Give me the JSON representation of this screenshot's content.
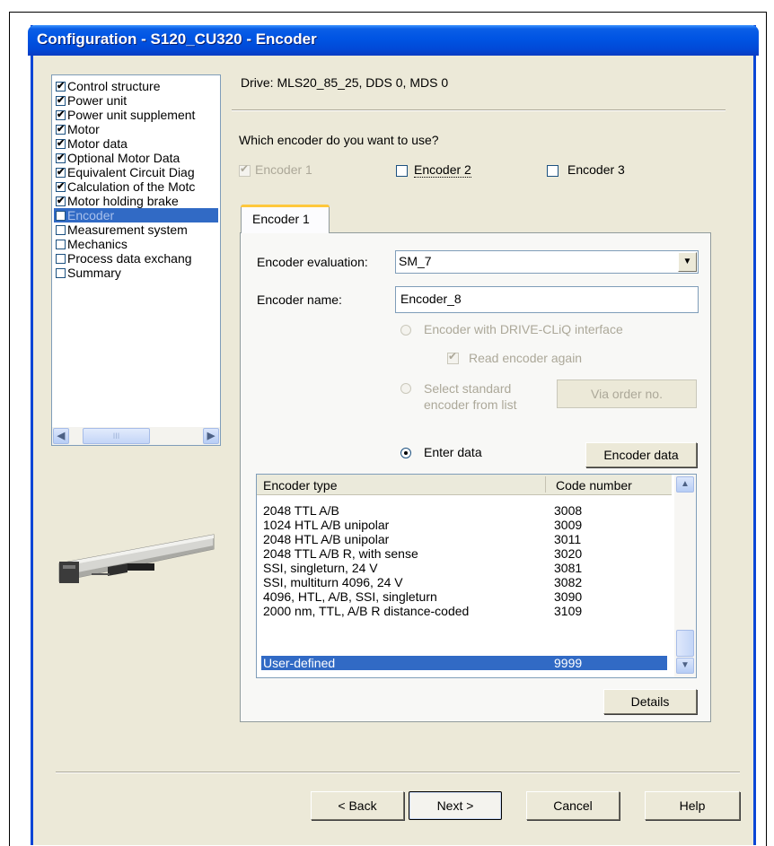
{
  "window": {
    "title": "Configuration - S120_CU320 - Encoder"
  },
  "sidebar": {
    "items": [
      {
        "label": "Control structure",
        "checked": true
      },
      {
        "label": "Power unit",
        "checked": true
      },
      {
        "label": "Power unit supplement",
        "checked": true
      },
      {
        "label": "Motor",
        "checked": true
      },
      {
        "label": "Motor data",
        "checked": true
      },
      {
        "label": "Optional Motor Data",
        "checked": true
      },
      {
        "label": "Equivalent Circuit Diag",
        "checked": true
      },
      {
        "label": "Calculation of the Motc",
        "checked": true
      },
      {
        "label": "Motor holding brake",
        "checked": true
      },
      {
        "label": "Encoder",
        "checked": false,
        "selected": true
      },
      {
        "label": "Measurement system",
        "checked": false
      },
      {
        "label": "Mechanics",
        "checked": false
      },
      {
        "label": "Process data exchang",
        "checked": false
      },
      {
        "label": "Summary",
        "checked": false
      }
    ],
    "scroll_thumb": "III"
  },
  "drive_info": "Drive: MLS20_85_25, DDS 0, MDS 0",
  "question": "Which encoder do you want to use?",
  "encoder_choices": [
    {
      "label": "Encoder 1",
      "checked": true,
      "enabled": false
    },
    {
      "label": "Encoder 2",
      "checked": false,
      "enabled": true
    },
    {
      "label": "Encoder 3",
      "checked": false,
      "enabled": true
    }
  ],
  "tab": {
    "label": "Encoder 1"
  },
  "form": {
    "evaluation_label": "Encoder evaluation:",
    "evaluation_value": "SM_7",
    "name_label": "Encoder name:",
    "name_value": "Encoder_8",
    "radio_driveclq": "Encoder with DRIVE-CLiQ interface",
    "read_again": "Read encoder again",
    "radio_standard_line1": "Select standard",
    "radio_standard_line2": "encoder from list",
    "via_order_button": "Via order no.",
    "radio_enter_data": "Enter data",
    "encoder_data_button": "Encoder data",
    "details_button": "Details"
  },
  "encoder_list": {
    "headers": [
      "Encoder type",
      "Code number"
    ],
    "rows": [
      {
        "type": "2048 TTL A/B",
        "code": "3008"
      },
      {
        "type": "1024 HTL A/B unipolar",
        "code": "3009"
      },
      {
        "type": "2048 HTL A/B unipolar",
        "code": "3011"
      },
      {
        "type": "2048 TTL A/B R, with sense",
        "code": "3020"
      },
      {
        "type": "SSI, singleturn, 24 V",
        "code": "3081"
      },
      {
        "type": "SSI, multiturn 4096, 24 V",
        "code": "3082"
      },
      {
        "type": "4096, HTL, A/B, SSI, singleturn",
        "code": "3090"
      },
      {
        "type": "2000 nm, TTL, A/B R distance-coded",
        "code": "3109"
      },
      {
        "type": "User-defined",
        "code": "9999",
        "selected": true
      }
    ]
  },
  "footer": {
    "back": "< Back",
    "next": "Next >",
    "cancel": "Cancel",
    "help": "Help"
  },
  "colors": {
    "title_bar": "#0054e3",
    "window_bg": "#ece9d8",
    "selection": "#316ac5",
    "disabled_text": "#aca899"
  },
  "icons": {
    "scroll_left": "◀",
    "scroll_right": "▶",
    "scroll_up": "▲",
    "scroll_down": "▼",
    "dropdown": "▼"
  }
}
